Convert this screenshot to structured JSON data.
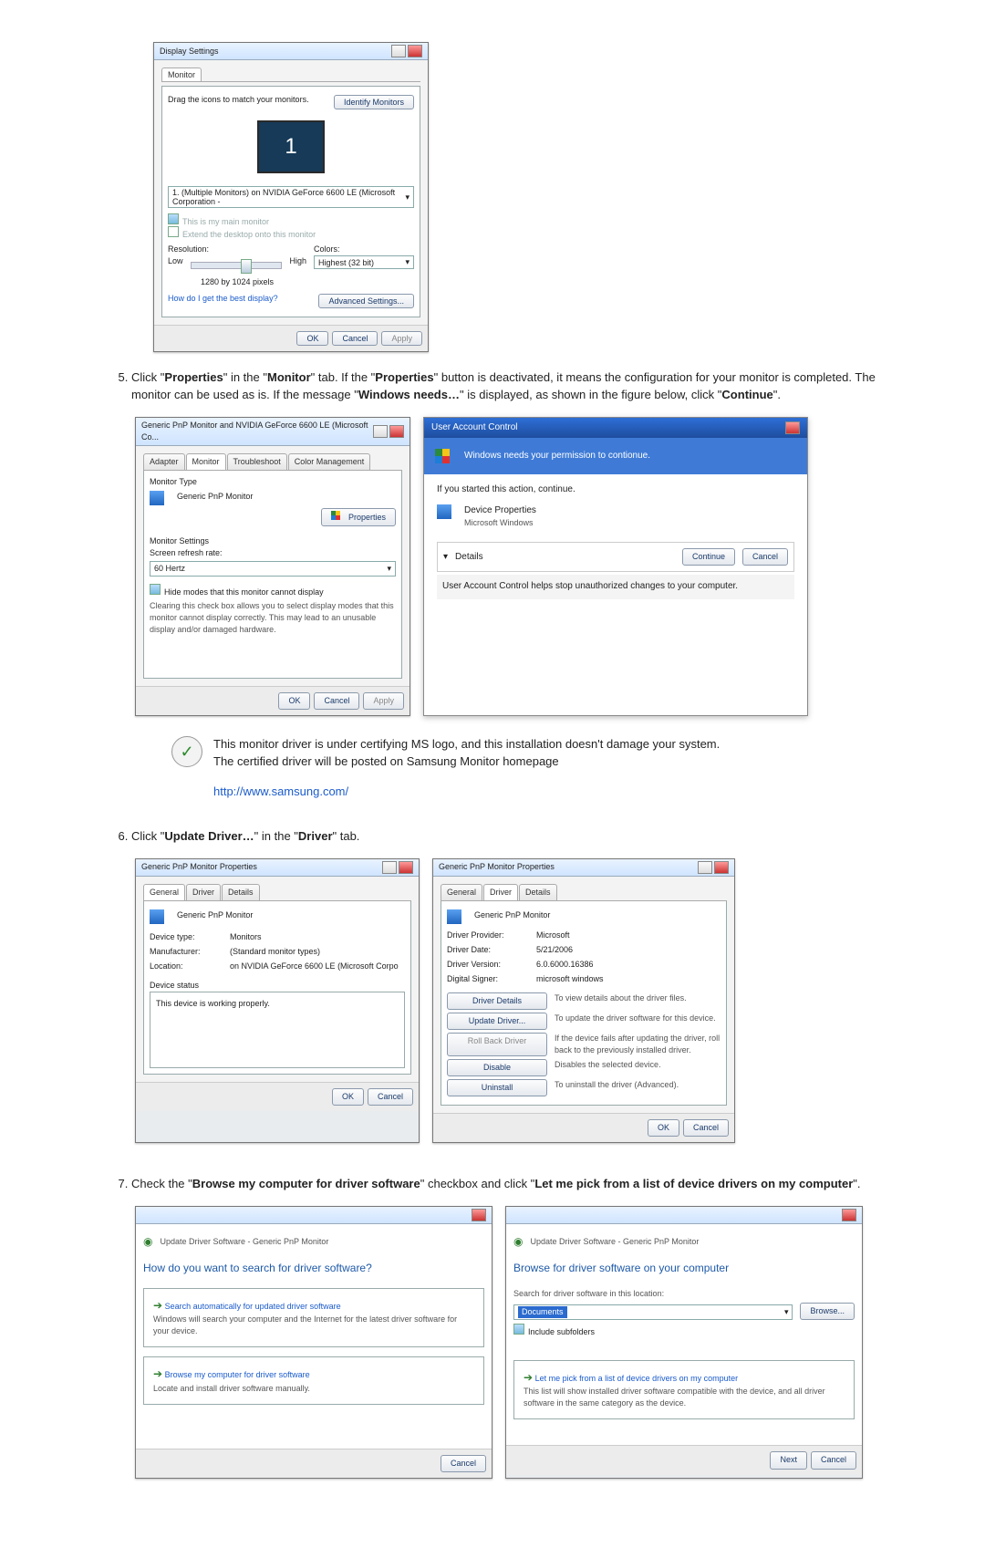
{
  "steps": {
    "s5": {
      "num": "5.",
      "text_a": "Click \"",
      "props": "Properties",
      "text_b": "\" in the \"",
      "monitor": "Monitor",
      "text_c": "\" tab. If the \"",
      "text_d": "\" button is deactivated, it means the configuration for your monitor is completed. The monitor can be used as is. If the message \"",
      "winneeds": "Windows needs…",
      "text_e": "\" is displayed, as shown in the figure below, click \"",
      "continue": "Continue",
      "text_f": "\"."
    },
    "s6": {
      "num": "6.",
      "text_a": "Click \"",
      "update": "Update Driver…",
      "text_b": "\" in the \"",
      "driver": "Driver",
      "text_c": "\" tab."
    },
    "s7": {
      "num": "7.",
      "text_a": "Check the \"",
      "browse": "Browse my computer for driver software",
      "text_b": "\" checkbox and click \"",
      "let": "Let me pick from a list of device drivers on my computer",
      "text_c": "\"."
    }
  },
  "note": {
    "l1": "This monitor driver is under certifying MS logo, and this installation doesn't damage your system.",
    "l2": "The certified driver will be posted on Samsung Monitor homepage",
    "url": "http://www.samsung.com/"
  },
  "shot1": {
    "title": "Display Settings",
    "tab": "Monitor",
    "drag": "Drag the icons to match your monitors.",
    "identify": "Identify Monitors",
    "mon1": "1",
    "picklabel": "1. (Multiple Monitors) on NVIDIA GeForce 6600 LE (Microsoft Corporation -",
    "cb1": "This is my main monitor",
    "cb2": "Extend the desktop onto this monitor",
    "res": "Resolution:",
    "low": "Low",
    "high": "High",
    "resval": "1280 by 1024 pixels",
    "col": "Colors:",
    "colval": "Highest (32 bit)",
    "help": "How do I get the best display?",
    "adv": "Advanced Settings...",
    "ok": "OK",
    "cancel": "Cancel",
    "apply": "Apply"
  },
  "shot2": {
    "title": "Generic PnP Monitor and NVIDIA GeForce 6600 LE (Microsoft Co...",
    "tabs": {
      "a": "Adapter",
      "b": "Monitor",
      "c": "Troubleshoot",
      "d": "Color Management"
    },
    "mt": "Monitor Type",
    "mtv": "Generic PnP Monitor",
    "props": "Properties",
    "ms": "Monitor Settings",
    "srr": "Screen refresh rate:",
    "srrv": "60 Hertz",
    "cb": "Hide modes that this monitor cannot display",
    "warn": "Clearing this check box allows you to select display modes that this monitor cannot display correctly. This may lead to an unusable display and/or damaged hardware.",
    "ok": "OK",
    "cancel": "Cancel",
    "apply": "Apply"
  },
  "uac": {
    "title": "User Account Control",
    "msg": "Windows needs your permission to contionue.",
    "started": "If you started this action, continue.",
    "dp": "Device Properties",
    "mw": "Microsoft Windows",
    "details": "Details",
    "continue": "Continue",
    "cancel": "Cancel",
    "foot": "User Account Control helps stop unauthorized changes to your computer."
  },
  "shot3": {
    "title": "Generic PnP Monitor Properties",
    "tabs": {
      "a": "General",
      "b": "Driver",
      "c": "Details"
    },
    "name": "Generic PnP Monitor",
    "dt": "Device type:",
    "dtv": "Monitors",
    "mf": "Manufacturer:",
    "mfv": "(Standard monitor types)",
    "loc": "Location:",
    "locv": "on NVIDIA GeForce 6600 LE (Microsoft Corpo",
    "ds": "Device status",
    "dsv": "This device is working properly.",
    "ok": "OK",
    "cancel": "Cancel"
  },
  "shot4": {
    "title": "Generic PnP Monitor Properties",
    "tabs": {
      "a": "General",
      "b": "Driver",
      "c": "Details"
    },
    "name": "Generic PnP Monitor",
    "dp": "Driver Provider:",
    "dpv": "Microsoft",
    "dd": "Driver Date:",
    "ddv": "5/21/2006",
    "dv": "Driver Version:",
    "dvv": "6.0.6000.16386",
    "dsig": "Digital Signer:",
    "dsigv": "microsoft windows",
    "b1": "Driver Details",
    "b1d": "To view details about the driver files.",
    "b2": "Update Driver...",
    "b2d": "To update the driver software for this device.",
    "b3": "Roll Back Driver",
    "b3d": "If the device fails after updating the driver, roll back to the previously installed driver.",
    "b4": "Disable",
    "b4d": "Disables the selected device.",
    "b5": "Uninstall",
    "b5d": "To uninstall the driver (Advanced).",
    "ok": "OK",
    "cancel": "Cancel"
  },
  "wiz1": {
    "bc": "Update Driver Software - Generic PnP Monitor",
    "q": "How do you want to search for driver software?",
    "o1": "Search automatically for updated driver software",
    "o1d": "Windows will search your computer and the Internet for the latest driver software for your device.",
    "o2": "Browse my computer for driver software",
    "o2d": "Locate and install driver software manually.",
    "cancel": "Cancel"
  },
  "wiz2": {
    "bc": "Update Driver Software - Generic PnP Monitor",
    "h": "Browse for driver software on your computer",
    "sl": "Search for driver software in this location:",
    "path": "Documents",
    "browse": "Browse...",
    "cb": "Include subfolders",
    "o1": "Let me pick from a list of device drivers on my computer",
    "o1d": "This list will show installed driver software compatible with the device, and all driver software in the same category as the device.",
    "next": "Next",
    "cancel": "Cancel"
  }
}
